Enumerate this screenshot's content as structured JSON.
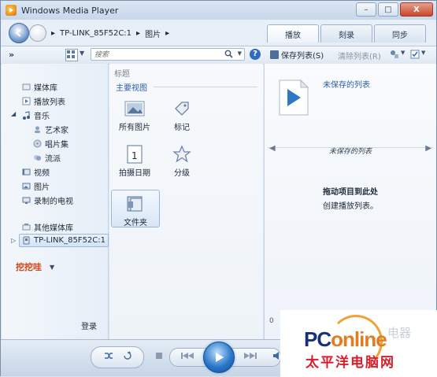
{
  "window": {
    "title": "Windows Media Player"
  },
  "title_controls": {
    "minimize": "–",
    "maximize": "□",
    "close": "X"
  },
  "breadcrumb": [
    "TP-LINK_85F52C:1",
    "图片"
  ],
  "breadcrumb_sep": "▸",
  "tabs": [
    {
      "label": "播放",
      "active": true
    },
    {
      "label": "刻录",
      "active": false
    },
    {
      "label": "同步",
      "active": false
    }
  ],
  "toolbar": {
    "expand_label": "»",
    "search_placeholder": "搜索",
    "help_label": "?",
    "save_list_label": "保存列表(S)",
    "clear_list_label": "清除列表(R)"
  },
  "sidebar": {
    "library_label": "媒体库",
    "playlists_label": "播放列表",
    "music_label": "音乐",
    "music_children": [
      "艺术家",
      "唱片集",
      "流派"
    ],
    "video_label": "视频",
    "pictures_label": "图片",
    "recorded_tv_label": "录制的电视",
    "other_libraries_label": "其他媒体库",
    "device_label": "TP-LINK_85F52C:1",
    "dig_label": "挖挖哇",
    "login_label": "登录"
  },
  "content": {
    "column_header": "标题",
    "group_header": "主要视图",
    "tiles": [
      {
        "label": "所有图片",
        "icon": "picture-icon"
      },
      {
        "label": "标记",
        "icon": "tag-icon"
      },
      {
        "label": "拍摄日期",
        "icon": "calendar-icon"
      },
      {
        "label": "分级",
        "icon": "star-icon"
      },
      {
        "label": "文件夹",
        "icon": "folder-icon"
      }
    ]
  },
  "list_pane": {
    "unsaved_title": "未保存的列表",
    "list_header": "未保存的列表",
    "drag_hint": "拖动项目到此处",
    "drag_sub": "创建播放列表。",
    "item_count": "0"
  },
  "watermark": {
    "brand_part1": "PC",
    "brand_part2": "online",
    "chinese": "太平洋电脑网",
    "faint": "电器"
  },
  "colors": {
    "accent": "#2f6cc0",
    "orange": "#d2461b",
    "brand_blue": "#17307a",
    "brand_red": "#d81e2a"
  }
}
